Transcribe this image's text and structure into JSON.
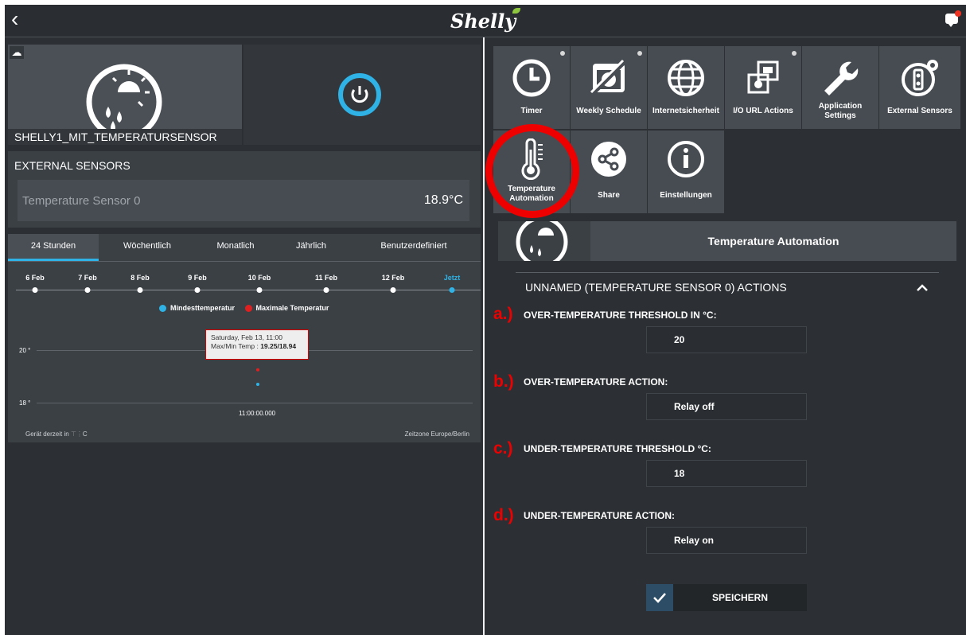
{
  "header": {
    "back": "‹",
    "logo": "Shelly"
  },
  "device": {
    "name": "SHELLY1_MIT_TEMPERATURSENSOR"
  },
  "external_sensors": {
    "heading": "EXTERNAL SENSORS",
    "sensor_name": "Temperature Sensor 0",
    "sensor_value": "18.9°C"
  },
  "chart_tabs": [
    "24 Stunden",
    "Wöchentlich",
    "Monatlich",
    "Jährlich",
    "Benutzerdefiniert"
  ],
  "timeline": [
    "6 Feb",
    "7 Feb",
    "8 Feb",
    "9 Feb",
    "10 Feb",
    "11 Feb",
    "12 Feb",
    "Jetzt"
  ],
  "chart_data": {
    "type": "scatter",
    "series": [
      {
        "name": "Mindesttemperatur",
        "color": "#2fb3e6",
        "points": [
          {
            "x": "Saturday, Feb 13, 11:00",
            "y": 18.94
          }
        ]
      },
      {
        "name": "Maximale Temperatur",
        "color": "#e02020",
        "points": [
          {
            "x": "Saturday, Feb 13, 11:00",
            "y": 19.25
          }
        ]
      }
    ],
    "yticks": [
      "20 °",
      "18 °"
    ],
    "x_tick": "11:00:00.000",
    "ylim": [
      18,
      20
    ],
    "tooltip_line1": "Saturday, Feb 13, 11:00",
    "tooltip_label": "Max/Min Temp : ",
    "tooltip_value": "19.25/18.94",
    "legend_placement": "top-center"
  },
  "chart_footer": {
    "left": "Gerät derzeit in",
    "left_unit": "C",
    "right": "Zeitzone Europe/Berlin"
  },
  "tiles": [
    {
      "label": "Timer",
      "icon": "clock-icon"
    },
    {
      "label": "Weekly Schedule",
      "icon": "calendar-icon"
    },
    {
      "label": "Internetsicherheit",
      "icon": "globe-icon"
    },
    {
      "label": "I/O URL Actions",
      "icon": "io-url-icon"
    },
    {
      "label": "Application Settings",
      "icon": "wrench-icon"
    },
    {
      "label": "External Sensors",
      "icon": "external-sensors-icon"
    },
    {
      "label": "Temperature Automation",
      "icon": "thermometer-icon"
    },
    {
      "label": "Share",
      "icon": "share-icon"
    },
    {
      "label": "Einstellungen",
      "icon": "info-icon"
    }
  ],
  "automation": {
    "title": "Temperature Automation",
    "actions_heading": "UNNAMED (TEMPERATURE SENSOR 0) ACTIONS",
    "fields": [
      {
        "marker": "a.)",
        "label": "OVER-TEMPERATURE THRESHOLD IN °C:",
        "value": "20"
      },
      {
        "marker": "b.)",
        "label": "OVER-TEMPERATURE ACTION:",
        "value": "Relay off"
      },
      {
        "marker": "c.)",
        "label": "UNDER-TEMPERATURE THRESHOLD °C:",
        "value": "18"
      },
      {
        "marker": "d.)",
        "label": "UNDER-TEMPERATURE ACTION:",
        "value": "Relay on"
      }
    ],
    "save_label": "SPEICHERN"
  },
  "colors": {
    "accent": "#2fb3e6",
    "highlight": "#e00000",
    "panel": "#2c3034"
  }
}
